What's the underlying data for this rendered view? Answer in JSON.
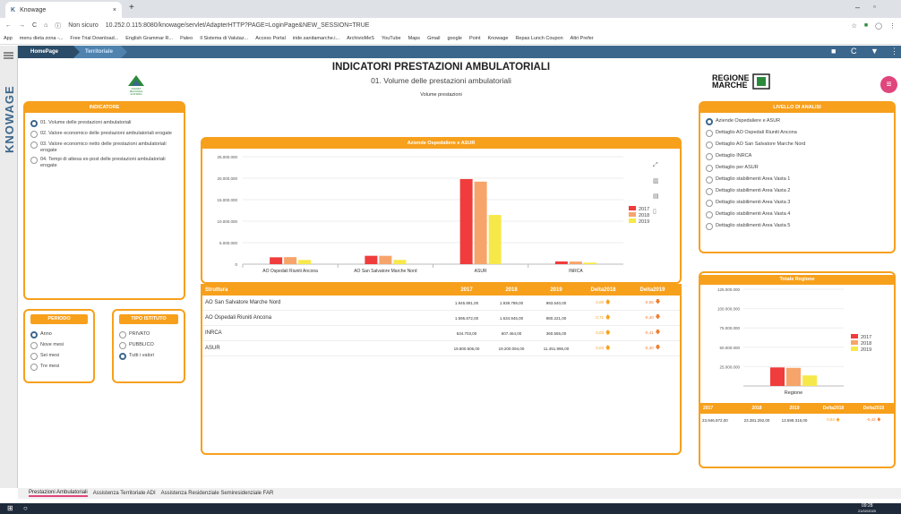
{
  "browser": {
    "tab_title": "Knowage",
    "security": "Non sicuro",
    "url": "10.252.0.115:8080/knowage/servlet/AdapterHTTP?PAGE=LoginPage&NEW_SESSION=TRUE",
    "bookmarks": [
      "App",
      "menu dieta zona -...",
      "Free Trial Download...",
      "English Grammar R...",
      "Paleo",
      "Il Sistema di Valutaz...",
      "Access Portal",
      "iride.sanitamarche.i...",
      "ArchivioMeS",
      "YouTube",
      "Maps",
      "Gmail",
      "google",
      "Point",
      "Knowage",
      "Repas Lunch Coupon",
      "Altri Prefer"
    ]
  },
  "app": {
    "brand": "KNOWAGE",
    "breadcrumbs": [
      "HomePage",
      "Territoriale"
    ],
    "title": "INDICATORI PRESTAZIONI AMBULATORIALI",
    "subtitle": "01. Volume delle prestazioni ambulatoriali",
    "chart_caption": "Volume prestazioni",
    "logo_text": "REGIONE MARCHE",
    "agency_logo_text": "AGENZIA REGIONALE SANITARIA"
  },
  "indicatore": {
    "title": "INDICATORE",
    "items": [
      {
        "label": "01. Volume delle prestazioni ambulatoriali",
        "selected": true
      },
      {
        "label": "02. Valore economico delle prestazioni ambulatoriali erogate",
        "selected": false
      },
      {
        "label": "03. Valore economico netto delle prestazioni ambulatoriali erogate",
        "selected": false
      },
      {
        "label": "04. Tempi di attesa ex-post delle prestazioni ambulatoriali erogate",
        "selected": false
      }
    ]
  },
  "periodo": {
    "title": "PERIODO",
    "items": [
      {
        "label": "Anno",
        "selected": true
      },
      {
        "label": "Nove mesi",
        "selected": false
      },
      {
        "label": "Sei mesi",
        "selected": false
      },
      {
        "label": "Tre mesi",
        "selected": false
      }
    ]
  },
  "tipo": {
    "title": "TIPO ISTITUTO",
    "items": [
      {
        "label": "PRIVATO",
        "selected": false
      },
      {
        "label": "PUBBLICO",
        "selected": false
      },
      {
        "label": "Tutti i valori",
        "selected": true
      }
    ]
  },
  "livello": {
    "title": "LIVELLO DI ANALISI",
    "items": [
      {
        "label": "Aziende Ospedaliere e ASUR",
        "selected": true
      },
      {
        "label": "Dettaglio AO Ospedali Riuniti Ancona",
        "selected": false
      },
      {
        "label": "Dettaglio AO San Salvatore Marche Nord",
        "selected": false
      },
      {
        "label": "Dettaglio INRCA",
        "selected": false
      },
      {
        "label": "Dettaglio per ASUR",
        "selected": false
      },
      {
        "label": "Dettaglio stabilimenti Area Vasta 1",
        "selected": false
      },
      {
        "label": "Dettaglio stabilimenti Area Vasta 2",
        "selected": false
      },
      {
        "label": "Dettaglio stabilimenti Area Vasta 3",
        "selected": false
      },
      {
        "label": "Dettaglio stabilimenti Area Vasta 4",
        "selected": false
      },
      {
        "label": "Dettaglio stabilimenti Area Vasta 5",
        "selected": false
      }
    ]
  },
  "colors": {
    "y2017": "#f03c3c",
    "y2018": "#f7a46b",
    "y2019": "#f7e84a",
    "accent": "#f7a01c",
    "nav": "#3b678c",
    "up": "#f7a01c",
    "down": "#f07b2c"
  },
  "chart_data": [
    {
      "type": "bar",
      "title": "Aziende Ospedaliere e ASUR",
      "categories": [
        "AO Ospedali Riuniti Ancona",
        "AO San Salvatore Marche Nord",
        "ASUR",
        "INRCA"
      ],
      "series": [
        {
          "name": "2017",
          "values": [
            1595872,
            1945891,
            19800506,
            634703
          ]
        },
        {
          "name": "2018",
          "values": [
            1634945,
            1938789,
            19200094,
            607464
          ]
        },
        {
          "name": "2019",
          "values": [
            980221,
            993540,
            11451996,
            360555
          ]
        }
      ],
      "ylim": [
        0,
        25000000
      ],
      "yticks": [
        "0",
        "5.000.000",
        "10.000.000",
        "15.000.000",
        "20.000.000",
        "25.000.000"
      ],
      "legend": "right"
    },
    {
      "type": "bar",
      "title": "Totale Regione",
      "categories": [
        "Regione"
      ],
      "series": [
        {
          "name": "2017",
          "values": [
            23946972
          ]
        },
        {
          "name": "2018",
          "values": [
            23381292
          ]
        },
        {
          "name": "2019",
          "values": [
            13599315
          ]
        }
      ],
      "ylim": [
        0,
        125000000
      ],
      "yticks": [
        "25.000.000",
        "50.000.000",
        "75.000.000",
        "100.000.000",
        "125.000.000"
      ],
      "legend": "right"
    }
  ],
  "table": {
    "headers": [
      "Struttura",
      "2017",
      "2018",
      "2019",
      "Delta2018",
      "Delta2019"
    ],
    "rows": [
      [
        "AO San Salvatore Marche Nord",
        "1.945.891,00",
        "1.938.789,00",
        "993.540,00",
        "0,00",
        "-0,55"
      ],
      [
        "AO Ospedali Riuniti Ancona",
        "1.595.872,00",
        "1.634.945,00",
        "980.221,00",
        "0,71",
        "-0,40"
      ],
      [
        "INRCA",
        "634.703,00",
        "607.464,00",
        "360.555,00",
        "0,03",
        "-0,41"
      ],
      [
        "ASUR",
        "19.800.506,00",
        "19.200.094,00",
        "11.451.996,00",
        "0,04",
        "-0,40"
      ]
    ]
  },
  "totale_table": {
    "headers": [
      "2017",
      "2018",
      "2019",
      "Delta2018",
      "Delta2019"
    ],
    "row": [
      "23.946.972,00",
      "23.381.292,00",
      "13.599.315,00",
      "0,64",
      "-0,42"
    ]
  },
  "bottom_tabs": [
    "Prestazioni Ambulatoriali",
    "Assistenza Territoriale ADI",
    "Assistenza Residenziale Semiresidenziale FAR"
  ],
  "taskbar": {
    "time": "09:28",
    "date": "21/02/2020"
  }
}
